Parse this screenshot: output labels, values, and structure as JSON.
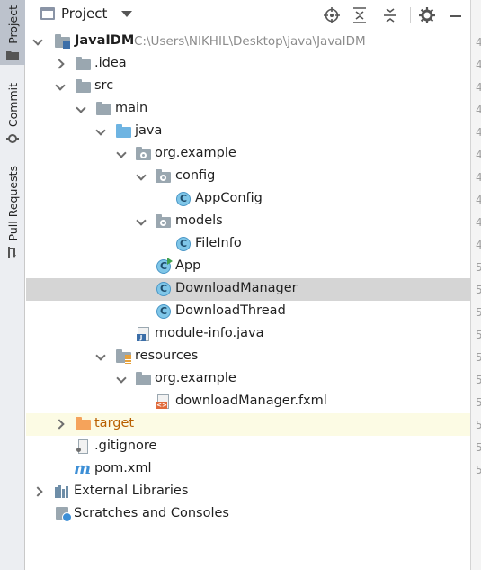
{
  "sidebar": {
    "tabs": [
      {
        "label": "Project",
        "icon": "folder-icon",
        "active": true
      },
      {
        "label": "Commit",
        "icon": "commit-icon",
        "active": false
      },
      {
        "label": "Pull Requests",
        "icon": "pull-request-icon",
        "active": false
      }
    ]
  },
  "header": {
    "title": "Project",
    "actions": [
      "locate-icon",
      "expand-all-icon",
      "collapse-all-icon",
      "gear-icon",
      "minimize-icon"
    ]
  },
  "tree": {
    "project": {
      "name": "JavaIDM",
      "path": "C:\\Users\\NIKHIL\\Desktop\\java\\JavaIDM"
    },
    "idea": ".idea",
    "src": "src",
    "main": "main",
    "java": "java",
    "pkg": "org.example",
    "config": "config",
    "appconfig": "AppConfig",
    "models": "models",
    "fileinfo": "FileInfo",
    "app": "App",
    "downloadmanager": "DownloadManager",
    "downloadthread": "DownloadThread",
    "moduleinfo": "module-info.java",
    "resources": "resources",
    "respkg": "org.example",
    "fxml": "downloadManager.fxml",
    "target": "target",
    "gitignore": ".gitignore",
    "pom": "pom.xml",
    "libraries": "External Libraries",
    "scratches": "Scratches and Consoles"
  },
  "gutter": {
    "digits": [
      "4",
      "4",
      "4",
      "4",
      "4",
      "4",
      "4",
      "4",
      "4",
      "4",
      "5",
      "5",
      "5",
      "5",
      "5",
      "5",
      "5",
      "5",
      "5",
      "5"
    ]
  },
  "colors": {
    "selected_row": "#d5d5d5",
    "excluded_row": "#fcfbe4",
    "excluded_text": "#b95f00",
    "path_text": "#8c8c8c"
  }
}
